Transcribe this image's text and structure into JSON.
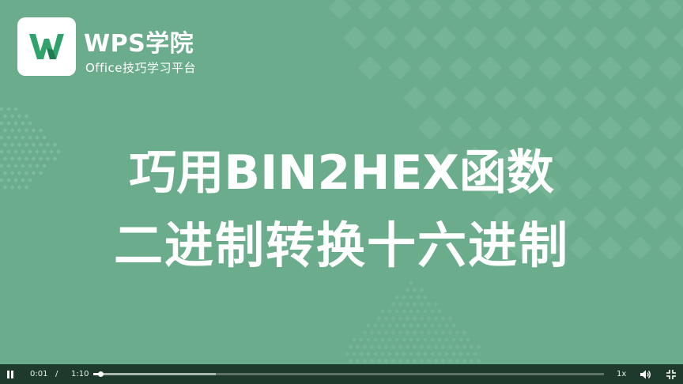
{
  "brand": {
    "name": "WPS学院",
    "subtitle": "Office技巧学习平台",
    "logo_icon": "wps-logo-icon"
  },
  "title": {
    "line1": "巧用BIN2HEX函数",
    "line2": "二进制转换十六进制"
  },
  "player": {
    "current_time": "0:01",
    "separator": "/",
    "total_time": "1:10",
    "speed": "1x",
    "progress_fraction": 0.014,
    "buffered_fraction": 0.24,
    "icons": {
      "play_pause": "pause-icon",
      "volume": "volume-icon",
      "fullscreen": "exit-fullscreen-icon"
    }
  },
  "colors": {
    "background": "#6aac8c",
    "diamonds": "#7dbd9c",
    "control_bar": "#1e3a2c",
    "text": "#ffffff"
  }
}
